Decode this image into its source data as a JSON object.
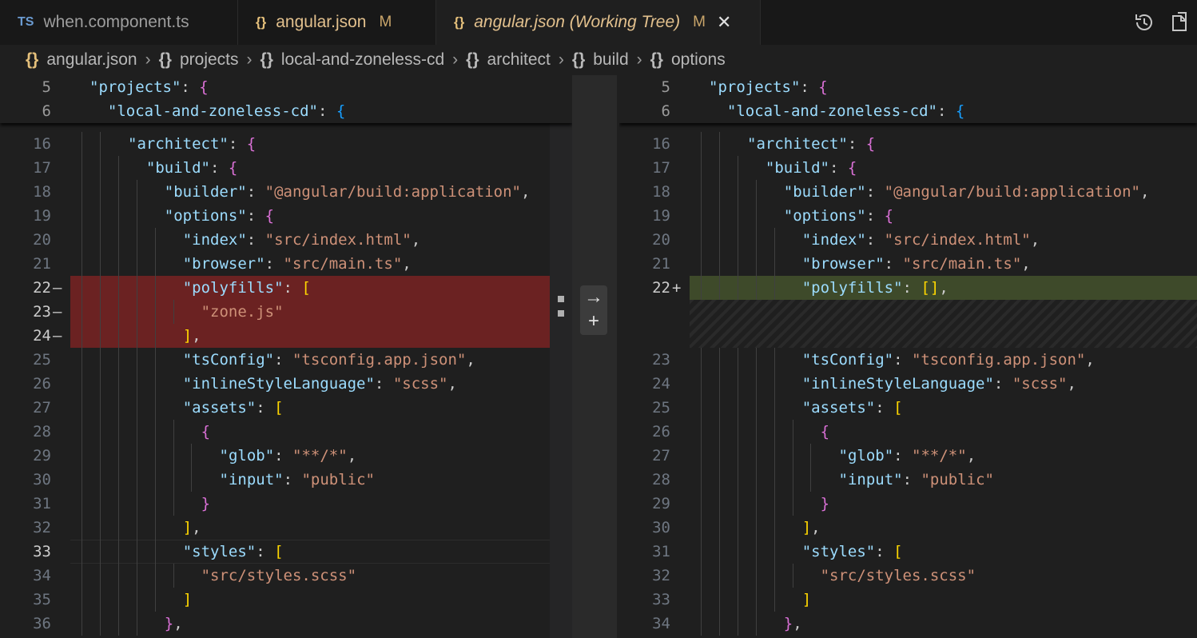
{
  "tabs": [
    {
      "icon": "TS",
      "label": "when.component.ts",
      "modified": "",
      "active": false
    },
    {
      "icon": "{}",
      "label": "angular.json",
      "modified": "M",
      "active": false
    },
    {
      "icon": "{}",
      "label": "angular.json (Working Tree)",
      "modified": "M",
      "active": true
    }
  ],
  "toolbar_icons": [
    "history-icon",
    "open-file-icon"
  ],
  "breadcrumb": [
    {
      "icon": "{}",
      "label": "angular.json"
    },
    {
      "icon": "{}",
      "label": "projects"
    },
    {
      "icon": "{}",
      "label": "local-and-zoneless-cd"
    },
    {
      "icon": "{}",
      "label": "architect"
    },
    {
      "icon": "{}",
      "label": "build"
    },
    {
      "icon": "{}",
      "label": "options"
    }
  ],
  "sticky": {
    "left": [
      {
        "ln": "5",
        "text": "\"projects\": {"
      },
      {
        "ln": "6",
        "text": "\"local-and-zoneless-cd\": {"
      }
    ],
    "right": [
      {
        "ln": "5",
        "text": "\"projects\": {"
      },
      {
        "ln": "6",
        "text": "\"local-and-zoneless-cd\": {"
      }
    ]
  },
  "left_lines": [
    {
      "ln": "16",
      "mark": "",
      "type": "",
      "text": "\"architect\": {"
    },
    {
      "ln": "17",
      "mark": "",
      "type": "",
      "text": "\"build\": {"
    },
    {
      "ln": "18",
      "mark": "",
      "type": "",
      "text": "\"builder\": \"@angular/build:application\","
    },
    {
      "ln": "19",
      "mark": "",
      "type": "",
      "text": "\"options\": {"
    },
    {
      "ln": "20",
      "mark": "",
      "type": "",
      "text": "\"index\": \"src/index.html\","
    },
    {
      "ln": "21",
      "mark": "",
      "type": "",
      "text": "\"browser\": \"src/main.ts\","
    },
    {
      "ln": "22",
      "mark": "—",
      "type": "del",
      "text": "\"polyfills\": ["
    },
    {
      "ln": "23",
      "mark": "—",
      "type": "del",
      "text": "\"zone.js\""
    },
    {
      "ln": "24",
      "mark": "—",
      "type": "del",
      "text": "],"
    },
    {
      "ln": "25",
      "mark": "",
      "type": "",
      "text": "\"tsConfig\": \"tsconfig.app.json\","
    },
    {
      "ln": "26",
      "mark": "",
      "type": "",
      "text": "\"inlineStyleLanguage\": \"scss\","
    },
    {
      "ln": "27",
      "mark": "",
      "type": "",
      "text": "\"assets\": ["
    },
    {
      "ln": "28",
      "mark": "",
      "type": "",
      "text": "{"
    },
    {
      "ln": "29",
      "mark": "",
      "type": "",
      "text": "\"glob\": \"**/*\","
    },
    {
      "ln": "30",
      "mark": "",
      "type": "",
      "text": "\"input\": \"public\""
    },
    {
      "ln": "31",
      "mark": "",
      "type": "",
      "text": "}"
    },
    {
      "ln": "32",
      "mark": "",
      "type": "",
      "text": "],"
    },
    {
      "ln": "33",
      "mark": "",
      "type": "cur",
      "text": "\"styles\": ["
    },
    {
      "ln": "34",
      "mark": "",
      "type": "",
      "text": "\"src/styles.scss\""
    },
    {
      "ln": "35",
      "mark": "",
      "type": "",
      "text": "]"
    },
    {
      "ln": "36",
      "mark": "",
      "type": "",
      "text": "},"
    }
  ],
  "right_lines": [
    {
      "ln": "16",
      "mark": "",
      "type": "",
      "text": "\"architect\": {"
    },
    {
      "ln": "17",
      "mark": "",
      "type": "",
      "text": "\"build\": {"
    },
    {
      "ln": "18",
      "mark": "",
      "type": "",
      "text": "\"builder\": \"@angular/build:application\","
    },
    {
      "ln": "19",
      "mark": "",
      "type": "",
      "text": "\"options\": {"
    },
    {
      "ln": "20",
      "mark": "",
      "type": "",
      "text": "\"index\": \"src/index.html\","
    },
    {
      "ln": "21",
      "mark": "",
      "type": "",
      "text": "\"browser\": \"src/main.ts\","
    },
    {
      "ln": "22",
      "mark": "+",
      "type": "add",
      "text": "\"polyfills\": [],"
    },
    {
      "ln": "",
      "mark": "",
      "type": "gap",
      "text": ""
    },
    {
      "ln": "",
      "mark": "",
      "type": "gap",
      "text": ""
    },
    {
      "ln": "23",
      "mark": "",
      "type": "",
      "text": "\"tsConfig\": \"tsconfig.app.json\","
    },
    {
      "ln": "24",
      "mark": "",
      "type": "",
      "text": "\"inlineStyleLanguage\": \"scss\","
    },
    {
      "ln": "25",
      "mark": "",
      "type": "",
      "text": "\"assets\": ["
    },
    {
      "ln": "26",
      "mark": "",
      "type": "",
      "text": "{"
    },
    {
      "ln": "27",
      "mark": "",
      "type": "",
      "text": "\"glob\": \"**/*\","
    },
    {
      "ln": "28",
      "mark": "",
      "type": "",
      "text": "\"input\": \"public\""
    },
    {
      "ln": "29",
      "mark": "",
      "type": "",
      "text": "}"
    },
    {
      "ln": "30",
      "mark": "",
      "type": "",
      "text": "],"
    },
    {
      "ln": "31",
      "mark": "",
      "type": "",
      "text": "\"styles\": ["
    },
    {
      "ln": "32",
      "mark": "",
      "type": "",
      "text": "\"src/styles.scss\""
    },
    {
      "ln": "33",
      "mark": "",
      "type": "",
      "text": "]"
    },
    {
      "ln": "34",
      "mark": "",
      "type": "",
      "text": "},"
    }
  ],
  "revert_arrow": "→",
  "revert_plus": "+",
  "colors": {
    "deleted": "#6b2222",
    "added": "#3e4a2a",
    "key": "#9cdcfe",
    "string": "#ce9178"
  }
}
